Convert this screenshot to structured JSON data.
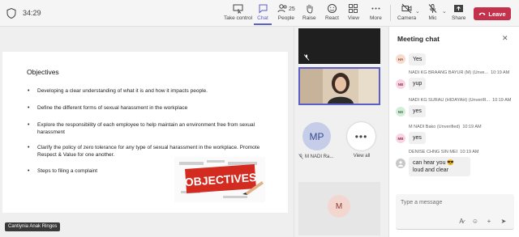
{
  "toolbar": {
    "timer": "34:29",
    "take_control": "Take control",
    "chat": "Chat",
    "people": "People",
    "people_count": "25",
    "raise": "Raise",
    "react": "React",
    "view": "View",
    "more": "More",
    "camera": "Camera",
    "mic": "Mic",
    "share": "Share",
    "leave": "Leave"
  },
  "slide": {
    "title": "Objectives",
    "bullets": [
      "Developing a clear understanding of what it is and how it impacts people.",
      "Define the different forms of sexual harassment in the workplace",
      "Explore the responsibility of each employee to help maintain an environment free from sexual harassment",
      "Clarify the policy of zero tolerance for any type of sexual harassment in the workplace. Promote Respect & Value for one another.",
      "Steps to filing a complaint"
    ],
    "image_text": "OBJECTIVES",
    "presenter": "Cantiynia Anak Ringos"
  },
  "participants": {
    "mp_initials": "MP",
    "mp_name": "M NADI Ra...",
    "view_all": "View all",
    "m_initials": "M"
  },
  "chat": {
    "title": "Meeting chat",
    "input_placeholder": "Type a message",
    "messages": [
      {
        "initials": "HA",
        "sender": "",
        "time": "",
        "text": "Yes"
      },
      {
        "initials": "NB",
        "sender": "NADI KG BRAANG BAYUR (M) (Unve...",
        "time": "10:19 AM",
        "text": "yup"
      },
      {
        "initials": "NS",
        "sender": "NADI KG SURAU (HIDAYAH) (UnveriR...",
        "time": "10:19 AM",
        "text": "yes"
      },
      {
        "initials": "MB",
        "sender": "M NADI Bako (Unverified)",
        "time": "10:19 AM",
        "text": "yes"
      },
      {
        "initials": "",
        "sender": "DENISE CHNG SIN MEI",
        "time": "10:19 AM",
        "text": "can hear you 😎 loud and clear"
      }
    ]
  },
  "colors": {
    "accent": "#5b5fc7",
    "leave": "#c4314b"
  }
}
